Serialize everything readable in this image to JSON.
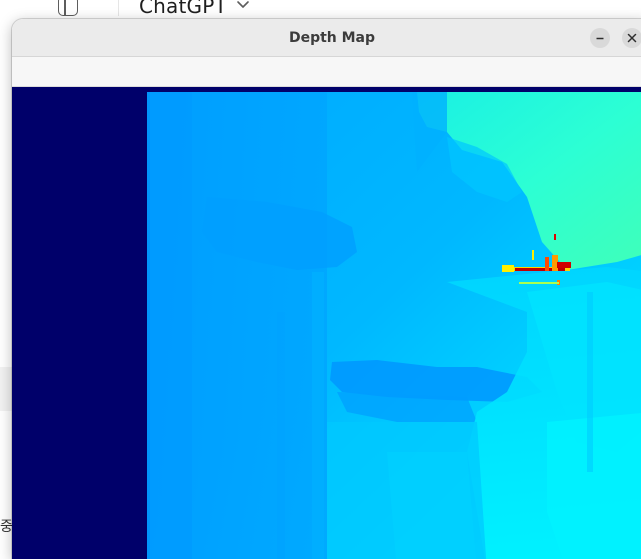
{
  "background_app": {
    "model_selector": "ChatGPT",
    "sidebar_toggle_icon": "sidebar-toggle-icon",
    "chevron_icon": "chevron-down-icon",
    "left_edge_text": "중"
  },
  "window": {
    "title": "Depth Map",
    "controls": {
      "minimize_icon": "minimize-icon",
      "close_icon": "close-icon"
    }
  },
  "depth_map": {
    "colormap": "jet",
    "border_color": "#00006a",
    "dominant_colors": [
      "#00a8ff",
      "#00e4ff",
      "#2cffcf",
      "#ffff00",
      "#c00000"
    ]
  }
}
